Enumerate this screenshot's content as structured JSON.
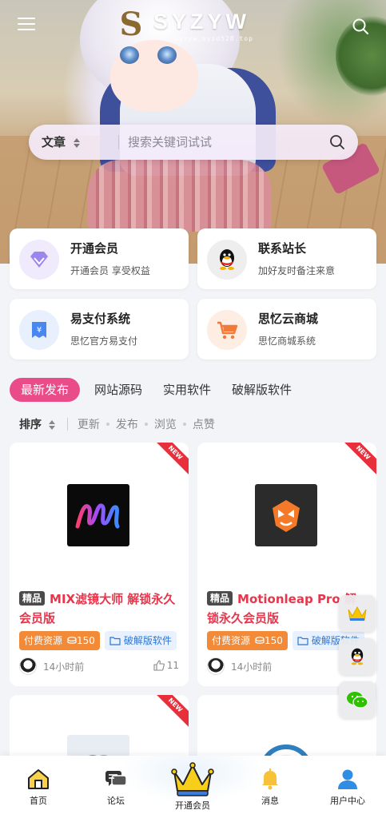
{
  "header": {
    "logo_mark": "S",
    "logo_text": "SYZYW",
    "logo_sub": "syzyw.syzd528.top"
  },
  "search": {
    "category": "文章",
    "placeholder": "搜索关键词试试"
  },
  "features": [
    {
      "title": "开通会员",
      "subtitle": "开通会员 享受权益",
      "icon": "diamond-icon",
      "color": "#8a6ee6"
    },
    {
      "title": "联系站长",
      "subtitle": "加好友时备注来意",
      "icon": "qq-penguin-icon",
      "color": "#222222"
    },
    {
      "title": "易支付系统",
      "subtitle": "思忆官方易支付",
      "icon": "payment-icon",
      "color": "#3d7cf0"
    },
    {
      "title": "思忆云商城",
      "subtitle": "思忆商城系统",
      "icon": "cart-icon",
      "color": "#f07a3a"
    }
  ],
  "tabs": [
    "最新发布",
    "网站源码",
    "实用软件",
    "破解版软件"
  ],
  "sort": {
    "label": "排序",
    "options": [
      "更新",
      "发布",
      "浏览",
      "点赞"
    ]
  },
  "posts": [
    {
      "badge": "NEW",
      "tag": "精品",
      "title": "MIX滤镜大师 解锁永久会员版",
      "paid_label": "付费资源",
      "price": "150",
      "category": "破解版软件",
      "time": "14小时前",
      "likes": "11"
    },
    {
      "badge": "NEW",
      "tag": "精品",
      "title": "Motionleap Pro 解锁永久会员版",
      "paid_label": "付费资源",
      "price": "150",
      "category": "破解版软件",
      "time": "14小时前",
      "likes": ""
    },
    {
      "badge": "NEW"
    },
    {
      "badge": ""
    }
  ],
  "bottom_nav": [
    {
      "label": "首页",
      "icon": "home-icon"
    },
    {
      "label": "论坛",
      "icon": "chat-bubbles-icon"
    },
    {
      "label": "开通会员",
      "icon": "crown-icon"
    },
    {
      "label": "消息",
      "icon": "bell-icon"
    },
    {
      "label": "用户中心",
      "icon": "user-icon"
    }
  ],
  "colors": {
    "accent": "#ea4c89",
    "title_red": "#e8354b",
    "paid_orange": "#f28a38",
    "category_blue": "#2c77d6"
  }
}
